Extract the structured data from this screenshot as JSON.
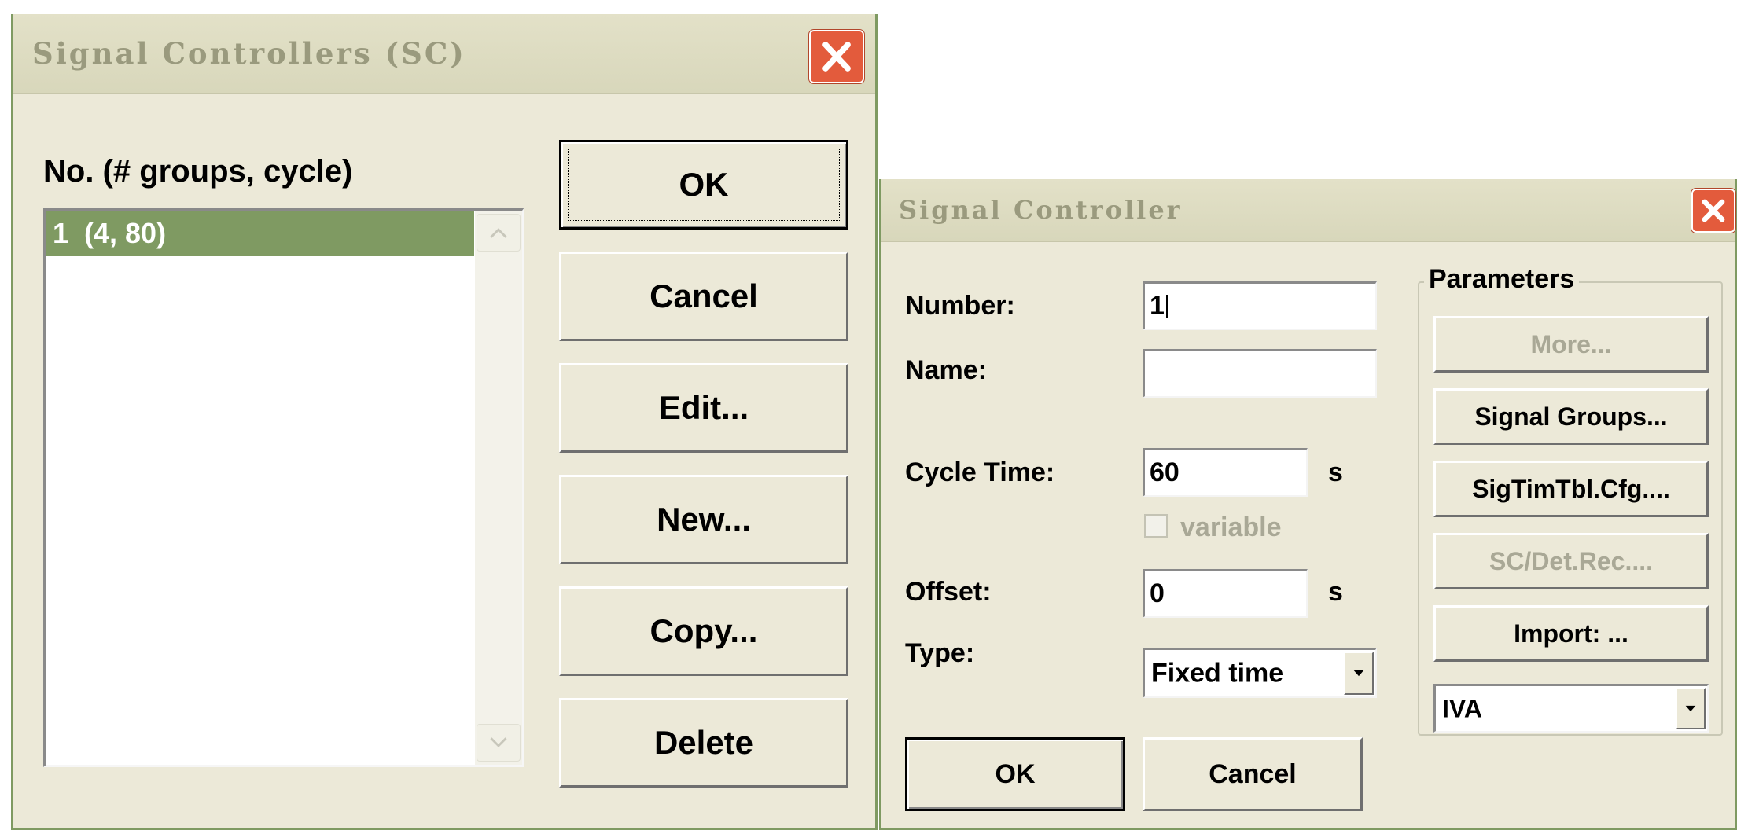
{
  "sc_list_window": {
    "title": "Signal Controllers (SC)",
    "list_header": "No. (# groups, cycle)",
    "items": [
      {
        "label": "1  (4, 80)",
        "selected": true
      }
    ],
    "buttons": {
      "ok": "OK",
      "cancel": "Cancel",
      "edit": "Edit...",
      "new": "New...",
      "copy": "Copy...",
      "delete": "Delete"
    }
  },
  "sc_edit_window": {
    "title": "Signal Controller",
    "number_label": "Number:",
    "number_value": "1",
    "name_label": "Name:",
    "name_value": "",
    "cycle_time_label": "Cycle Time:",
    "cycle_time_value": "60",
    "cycle_time_unit": "s",
    "variable_label": "variable",
    "variable_checked": false,
    "offset_label": "Offset:",
    "offset_value": "0",
    "offset_unit": "s",
    "type_label": "Type:",
    "type_value": "Fixed time",
    "ok": "OK",
    "cancel": "Cancel",
    "parameters": {
      "legend": "Parameters",
      "more": "More...",
      "signal_groups": "Signal Groups...",
      "sigtimtbl": "SigTimTbl.Cfg....",
      "sc_det_rec": "SC/Det.Rec....",
      "import": "Import: ...",
      "import_format": "IVA"
    }
  },
  "colors": {
    "window_bg": "#ece9d8",
    "titlebar_bg": "#dcdbc0",
    "title_text": "#9a9a7e",
    "frame": "#7f9a62",
    "selection": "#7f9a62",
    "close_button": "#e35b3c",
    "disabled_text": "#a9a896"
  },
  "icons": {
    "close": "close-icon",
    "scroll_up": "scroll-up-arrow-icon",
    "scroll_down": "scroll-down-arrow-icon",
    "dropdown": "chevron-down-icon"
  }
}
